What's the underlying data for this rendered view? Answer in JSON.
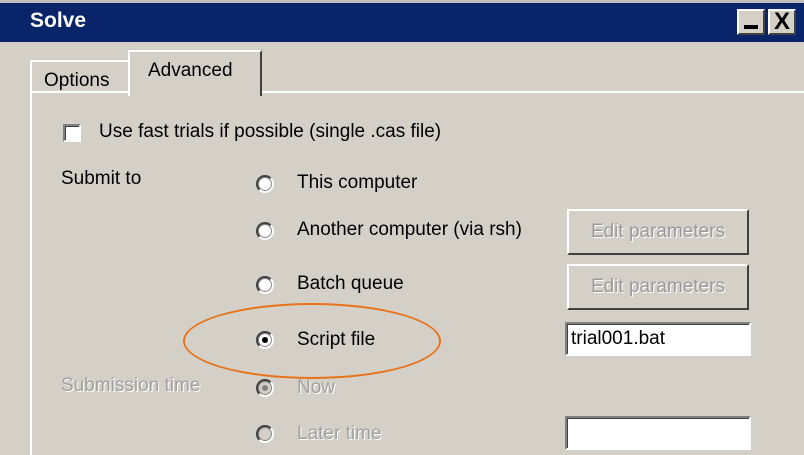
{
  "window": {
    "title": "Solve",
    "minimize_glyph": "_",
    "close_glyph": "X"
  },
  "tabs": [
    {
      "label": "Options",
      "active": false
    },
    {
      "label": "Advanced",
      "active": true
    }
  ],
  "fast_trials": {
    "label": "Use fast trials if possible (single .cas file)",
    "checked": false
  },
  "submit_to": {
    "label": "Submit to",
    "options": [
      {
        "label": "This computer",
        "selected": false
      },
      {
        "label": "Another computer (via rsh)",
        "selected": false
      },
      {
        "label": "Batch queue",
        "selected": false
      },
      {
        "label": "Script file",
        "selected": true
      }
    ],
    "edit_button_label": "Edit parameters",
    "script_file_value": "trial001.bat"
  },
  "submission_time": {
    "label": "Submission time",
    "enabled": false,
    "options": [
      {
        "label": "Now",
        "selected": true
      },
      {
        "label": "Later time",
        "selected": false
      }
    ],
    "later_time_value": ""
  },
  "annotation": {
    "color": "#e8731b",
    "target": "Script file"
  },
  "colors": {
    "titlebar": "#0a246a",
    "face": "#d4d0c8",
    "disabled_text": "#a0a0a0"
  }
}
